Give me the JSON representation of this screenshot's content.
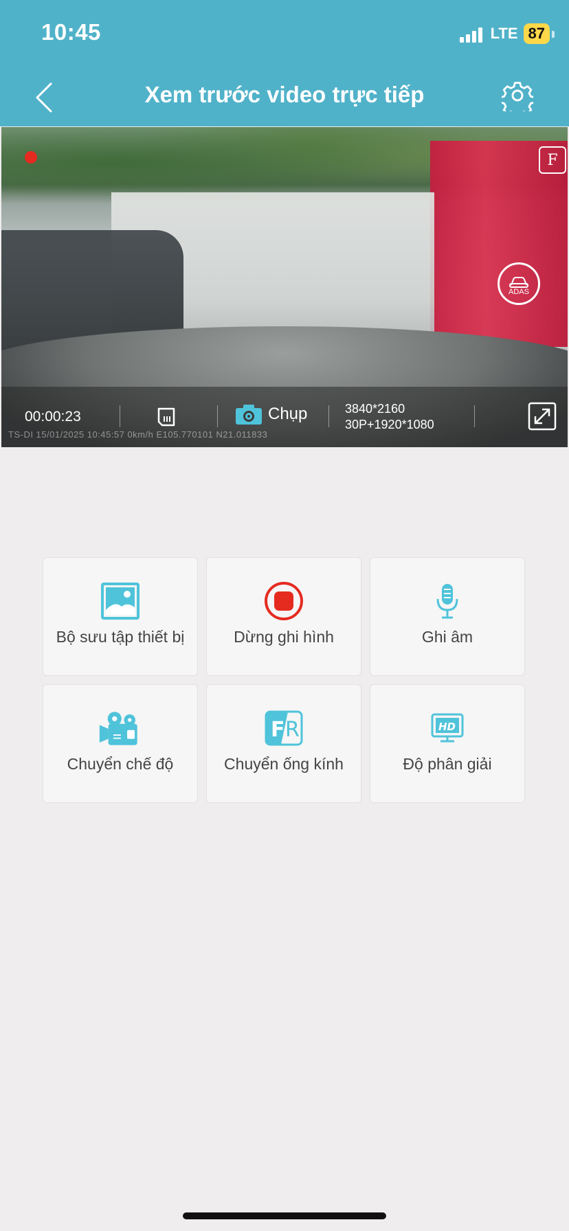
{
  "status_bar": {
    "time": "10:45",
    "network": "LTE",
    "battery": "87"
  },
  "header": {
    "title": "Xem trước video trực tiếp",
    "back_icon": "chevron-left-icon",
    "settings_icon": "gear-icon"
  },
  "video": {
    "lens_badge": "F",
    "adas_label": "ADAS",
    "recording_time": "00:00:23",
    "watermark": "TS-DI  15/01/2025  10:45:57   0km/h E105.770101  N21.011833",
    "capture_label": "Chụp",
    "resolution_line1": "3840*2160",
    "resolution_line2": "30P+1920*1080"
  },
  "actions": [
    {
      "label": "Bộ sưu tập thiết bị",
      "icon": "gallery-icon"
    },
    {
      "label": "Dừng ghi hình",
      "icon": "stop-record-icon"
    },
    {
      "label": "Ghi âm",
      "icon": "microphone-icon"
    },
    {
      "label": "Chuyển chế độ",
      "icon": "video-camera-icon"
    },
    {
      "label": "Chuyển ống kính",
      "icon": "front-rear-lens-icon"
    },
    {
      "label": "Độ phân giải",
      "icon": "hd-resolution-icon"
    }
  ],
  "colors": {
    "header": "#50b2c9",
    "accent": "#4fc3da",
    "record_red": "#e52b20"
  }
}
